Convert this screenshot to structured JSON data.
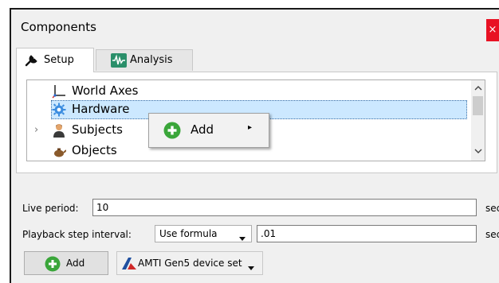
{
  "window": {
    "title": "Components",
    "close_glyph": "×"
  },
  "tabs": [
    {
      "label": "Setup",
      "icon": "wrench-icon",
      "active": true
    },
    {
      "label": "Analysis",
      "icon": "waveform-icon",
      "active": false
    }
  ],
  "tree": {
    "items": [
      {
        "label": "World Axes",
        "icon": "axes-icon",
        "selected": false,
        "expandable": false
      },
      {
        "label": "Hardware",
        "icon": "gear-icon",
        "selected": true,
        "expandable": false
      },
      {
        "label": "Subjects",
        "icon": "person-icon",
        "selected": false,
        "expandable": true
      },
      {
        "label": "Objects",
        "icon": "teapot-icon",
        "selected": false,
        "expandable": false
      }
    ],
    "expander_glyph": "›"
  },
  "context_menu": {
    "items": [
      {
        "label": "Add",
        "icon": "green-plus-icon",
        "submenu_glyph": "▸"
      }
    ]
  },
  "settings": {
    "live_period": {
      "label": "Live period:",
      "value": "10",
      "unit": "sec"
    },
    "playback_step": {
      "label": "Playback step interval:",
      "mode": "Use formula",
      "value": ".01",
      "unit": "sec"
    }
  },
  "bottom": {
    "add_label": "Add",
    "device_label": "AMTI Gen5 device set"
  },
  "colors": {
    "selection_bg": "#cce8ff",
    "close_red": "#e81123",
    "plus_green": "#3aa63a",
    "amti_blue": "#1f4fa0"
  }
}
